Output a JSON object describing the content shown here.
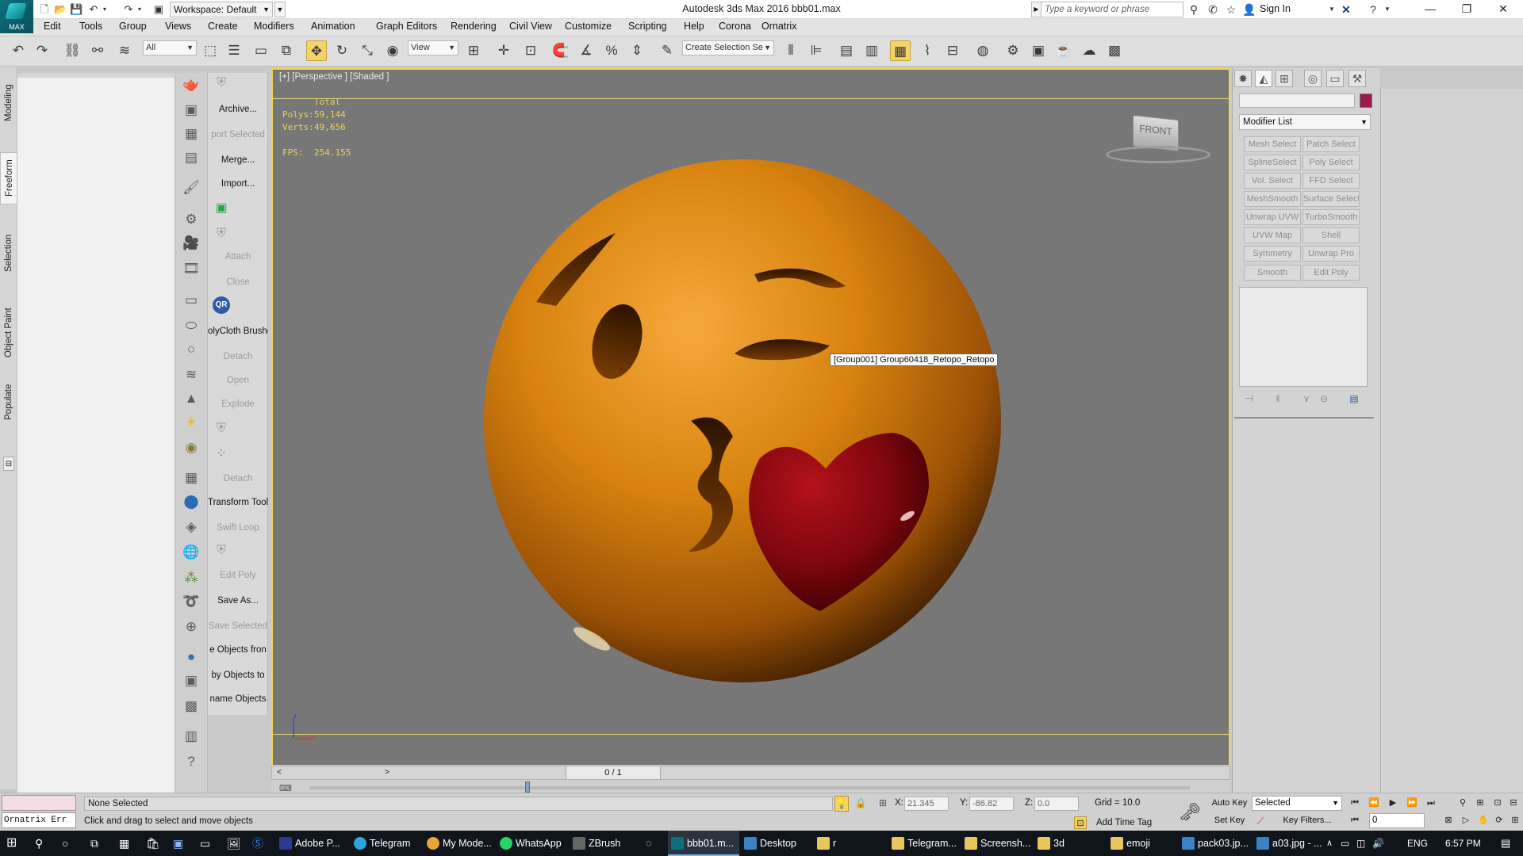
{
  "titlebar": {
    "logo_label": "MAX",
    "workspace": "Workspace: Default",
    "app_title": "Autodesk 3ds Max 2016      bbb01.max",
    "search_placeholder": "Type a keyword or phrase",
    "sign_in": "Sign In"
  },
  "menu": [
    "Edit",
    "Tools",
    "Group",
    "Views",
    "Create",
    "Modifiers",
    "Animation",
    "Graph Editors",
    "Rendering",
    "Civil View",
    "Customize",
    "Scripting",
    "Help",
    "Corona",
    "Ornatrix"
  ],
  "toolbar": {
    "selection_filter": "All",
    "ref_coord": "View",
    "named_selection": "Create Selection Se"
  },
  "ribbon_tabs": [
    "Modeling",
    "Freeform",
    "Selection",
    "Object Paint",
    "Populate"
  ],
  "script_panel": [
    {
      "label": "Archive...",
      "enabled": true
    },
    {
      "label": "port Selected",
      "enabled": false
    },
    {
      "label": "Merge...",
      "enabled": true
    },
    {
      "label": "Import...",
      "enabled": true
    },
    {
      "label": "Attach",
      "enabled": false
    },
    {
      "label": "Close",
      "enabled": false
    },
    {
      "label": "olyCloth Brushe",
      "enabled": true
    },
    {
      "label": "Detach",
      "enabled": false
    },
    {
      "label": "Open",
      "enabled": false
    },
    {
      "label": "Explode",
      "enabled": false
    },
    {
      "label": "Detach",
      "enabled": false
    },
    {
      "label": "Transform Tool",
      "enabled": true
    },
    {
      "label": "Swift Loop",
      "enabled": false
    },
    {
      "label": "Edit Poly",
      "enabled": false
    },
    {
      "label": "Save As...",
      "enabled": true
    },
    {
      "label": "Save Selected",
      "enabled": false
    },
    {
      "label": "e Objects fron",
      "enabled": true
    },
    {
      "label": "by Objects to",
      "enabled": true
    },
    {
      "label": "name Objects",
      "enabled": true
    }
  ],
  "viewport": {
    "label": "[+] [Perspective ] [Shaded ]",
    "stats_total": "Total",
    "polys_label": "Polys:",
    "polys_value": "59,144",
    "verts_label": "Verts:",
    "verts_value": "49,656",
    "fps_label": "FPS:",
    "fps_value": "254.155",
    "tooltip": "[Group001] Group60418_Retopo_Retopo",
    "viewcube_face": "FRONT"
  },
  "timeline": {
    "value": "0 / 1"
  },
  "command_panel": {
    "modifier_list": "Modifier List",
    "modifier_color": "#9b1a4b",
    "buttons": [
      [
        "Mesh Select",
        "Patch Select"
      ],
      [
        "SplineSelect",
        "Poly Select"
      ],
      [
        "Vol. Select",
        "FFD Select"
      ],
      [
        "MeshSmooth",
        "Surface Select"
      ],
      [
        "Unwrap UVW",
        "TurboSmooth"
      ],
      [
        "UVW Map",
        "Shell"
      ],
      [
        "Symmetry",
        "Unwrap Pro"
      ],
      [
        "Smooth",
        "Edit Poly"
      ]
    ]
  },
  "status": {
    "maxscript_text": "Ornatrix Err",
    "selection": "None Selected",
    "prompt": "Click and drag to select and move objects",
    "x_label": "X:",
    "x_value": "21.345",
    "y_label": "Y:",
    "y_value": "-86.82",
    "z_label": "Z:",
    "z_value": "0.0",
    "grid": "Grid = 10.0",
    "add_time_tag": "Add Time Tag",
    "auto_key": "Auto Key",
    "set_key": "Set Key",
    "selected": "Selected",
    "key_filters": "Key Filters...",
    "frame": "0"
  },
  "taskbar": {
    "items": [
      {
        "label": "Adobe P...",
        "color": "#2a3a8f",
        "active": false
      },
      {
        "label": "Telegram",
        "color": "#2ea4de",
        "active": false
      },
      {
        "label": "My Mode...",
        "color": "#e8a63a",
        "active": false
      },
      {
        "label": "WhatsApp",
        "color": "#25d366",
        "active": false
      },
      {
        "label": "ZBrush",
        "color": "#666666",
        "active": false
      },
      {
        "label": "bbb01.m...",
        "color": "#0e6f7c",
        "active": true
      },
      {
        "label": "Desktop",
        "color": "#3b82c4",
        "active": false
      },
      {
        "label": "r",
        "color": "#e8c65a",
        "active": false
      },
      {
        "label": "Telegram...",
        "color": "#e8c65a",
        "active": false
      },
      {
        "label": "Screensh...",
        "color": "#e8c65a",
        "active": false
      },
      {
        "label": "3d",
        "color": "#e8c65a",
        "active": false
      },
      {
        "label": "emoji",
        "color": "#e8c65a",
        "active": false
      },
      {
        "label": "pack03.jp...",
        "color": "#3b82c4",
        "active": false
      },
      {
        "label": "a03.jpg - ...",
        "color": "#3b82c4",
        "active": false
      }
    ],
    "language": "ENG",
    "time": "6:57 PM"
  }
}
